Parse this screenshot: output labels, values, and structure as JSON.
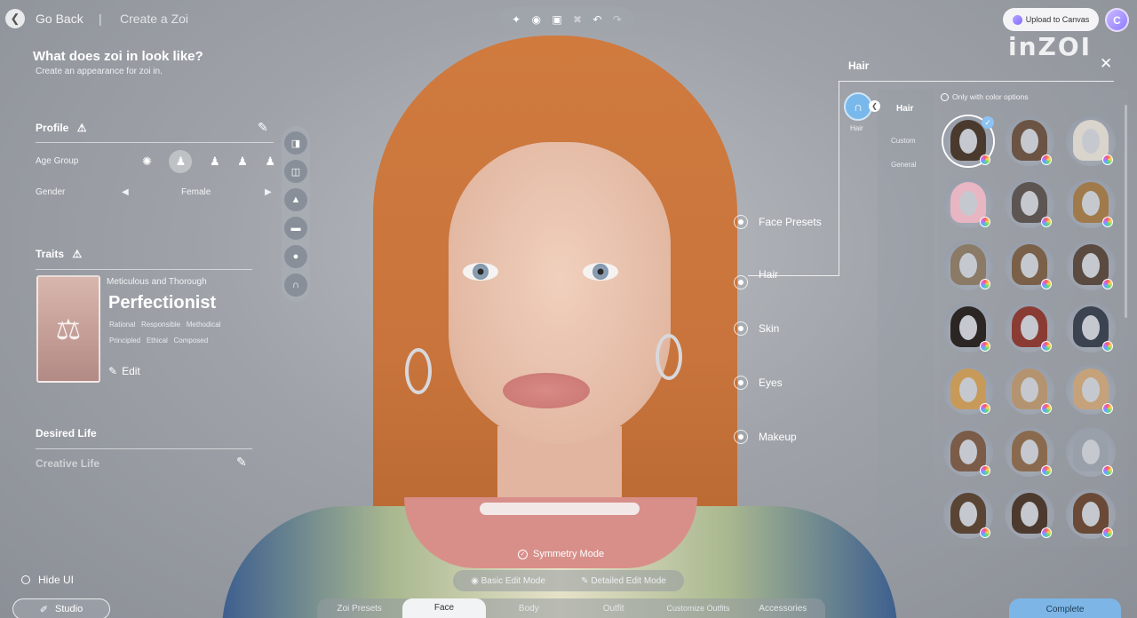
{
  "header": {
    "back_icon": "chevron-left-icon",
    "back_label": "Go Back",
    "separator": "|",
    "page_title": "Create a Zoi",
    "toolbar_icons": [
      "sparkle-icon",
      "camera-icon",
      "frame-icon",
      "eraser-icon",
      "undo-icon",
      "redo-icon"
    ],
    "upload_label": "Upload to Canvas",
    "logo": "inZOI"
  },
  "intro": {
    "title": "What does zoi in look like?",
    "subtitle": "Create an appearance for zoi in."
  },
  "profile": {
    "title": "Profile",
    "age_group_label": "Age Group",
    "gender_label": "Gender",
    "gender_value": "Female"
  },
  "traits": {
    "title": "Traits",
    "category": "Meticulous and Thorough",
    "name": "Perfectionist",
    "tags_row1": [
      "Rational",
      "Responsible",
      "Methodical"
    ],
    "tags_row2": [
      "Principled",
      "Ethical",
      "Composed"
    ],
    "edit_label": "Edit"
  },
  "desired_life": {
    "title": "Desired Life",
    "value": "Creative Life"
  },
  "face_parts": [
    "Face Presets",
    "Hair",
    "Skin",
    "Eyes",
    "Makeup"
  ],
  "hair_panel": {
    "title": "Hair",
    "category_label": "Hair",
    "subnav_title": "Hair",
    "subnav_items": [
      "Custom",
      "General"
    ],
    "filter_label": "Only with color options",
    "selected_index": 0,
    "hair_colors": [
      "#4a3a2e",
      "#6b5444",
      "#d9d4cc",
      "#e8b6c2",
      "#5c5552",
      "#a07a4a",
      "#8a7a66",
      "#7a6048",
      "#5a4a40",
      "#2b2624",
      "#8a3c34",
      "#3b4250",
      "#c89a5a",
      "#b49470",
      "#c6a27a",
      "#7a5c48",
      "#8a6a4e",
      "#9aa0aa",
      "#5a4434",
      "#4d3a2e",
      "#6a4a36"
    ]
  },
  "bottom": {
    "symmetry_label": "Symmetry Mode",
    "basic_mode": "Basic Edit Mode",
    "detailed_mode": "Detailed Edit Mode",
    "tabs": [
      "Zoi Presets",
      "Face",
      "Body",
      "Outfit",
      "Customize Outfits",
      "Accessories"
    ],
    "active_tab": "Face",
    "hide_ui_label": "Hide UI",
    "studio_label": "Studio",
    "complete_label": "Complete"
  }
}
